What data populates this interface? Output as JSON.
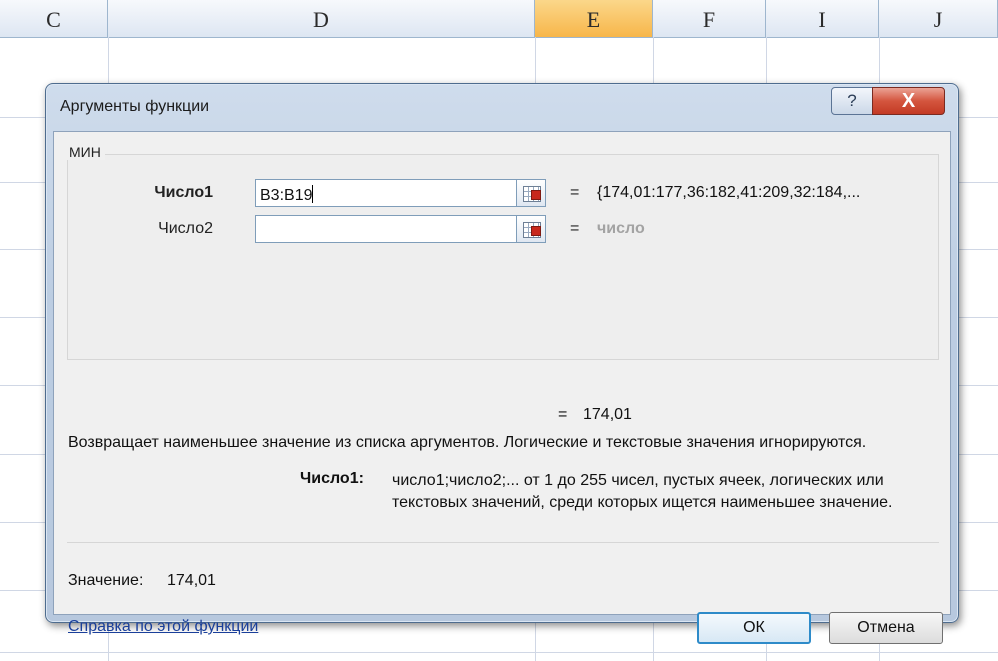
{
  "sheet": {
    "columns": [
      "C",
      "D",
      "E",
      "F",
      "I",
      "J"
    ],
    "active_column": "E"
  },
  "dialog": {
    "title": "Аргументы функции",
    "help_glyph": "?",
    "close_glyph": "X",
    "function_name": "МИН",
    "args": [
      {
        "label": "Число1",
        "value": "B3:B19",
        "result": "{174,01:177,36:182,41:209,32:184,..."
      },
      {
        "label": "Число2",
        "value": "",
        "result": "число"
      }
    ],
    "equals": "=",
    "formula_result": "174,01",
    "description": "Возвращает наименьшее значение из списка аргументов. Логические и текстовые значения игнорируются.",
    "param_name": "Число1:",
    "param_description": "число1;число2;... от 1 до 255 чисел, пустых ячеек, логических или текстовых значений, среди которых ищется наименьшее значение.",
    "value_label": "Значение:",
    "value": "174,01",
    "help_link": "Справка по этой функции",
    "ok_label": "ОК",
    "cancel_label": "Отмена"
  }
}
